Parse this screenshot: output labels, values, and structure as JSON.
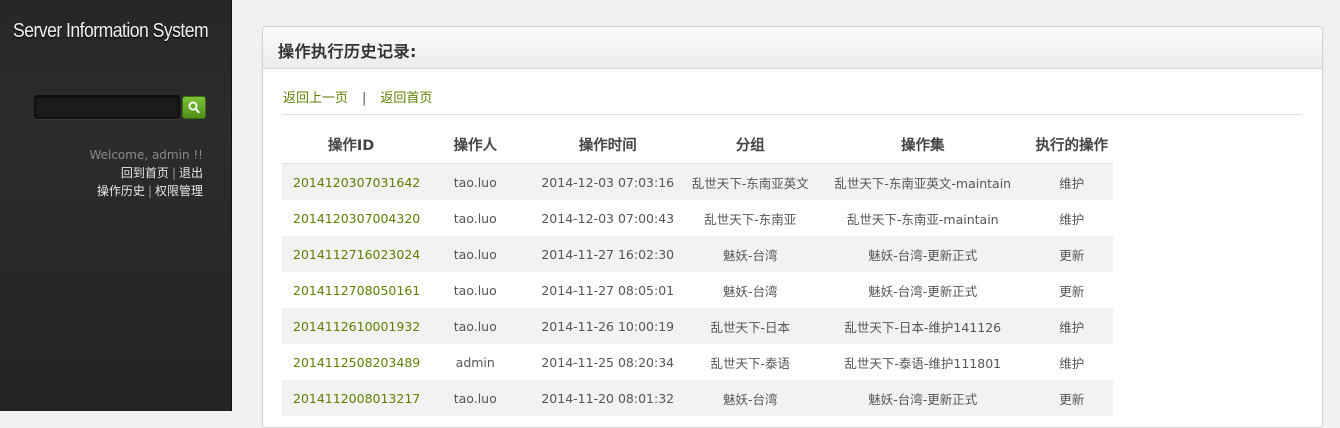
{
  "sidebar": {
    "app_title": "Server Information System",
    "search": {
      "value": "",
      "placeholder": ""
    },
    "welcome": "Welcome, admin !!",
    "links": {
      "home": "回到首页",
      "logout": "退出",
      "history": "操作历史",
      "permissions": "权限管理",
      "separator": "|"
    }
  },
  "panel": {
    "title": "操作执行历史记录:",
    "nav": {
      "back": "返回上一页",
      "separator": "|",
      "home": "返回首页"
    },
    "table": {
      "headers": [
        "操作ID",
        "操作人",
        "操作时间",
        "分组",
        "操作集",
        "执行的操作"
      ],
      "rows": [
        [
          "2014120307031642",
          "tao.luo",
          "2014-12-03 07:03:16",
          "乱世天下-东南亚英文",
          "乱世天下-东南亚英文-maintain",
          "维护"
        ],
        [
          "2014120307004320",
          "tao.luo",
          "2014-12-03 07:00:43",
          "乱世天下-东南亚",
          "乱世天下-东南亚-maintain",
          "维护"
        ],
        [
          "2014112716023024",
          "tao.luo",
          "2014-11-27 16:02:30",
          "魅妖-台湾",
          "魅妖-台湾-更新正式",
          "更新"
        ],
        [
          "2014112708050161",
          "tao.luo",
          "2014-11-27 08:05:01",
          "魅妖-台湾",
          "魅妖-台湾-更新正式",
          "更新"
        ],
        [
          "2014112610001932",
          "tao.luo",
          "2014-11-26 10:00:19",
          "乱世天下-日本",
          "乱世天下-日本-维护141126",
          "维护"
        ],
        [
          "2014112508203489",
          "admin",
          "2014-11-25 08:20:34",
          "乱世天下-泰语",
          "乱世天下-泰语-维护111801",
          "维护"
        ],
        [
          "2014112008013217",
          "tao.luo",
          "2014-11-20 08:01:32",
          "魅妖-台湾",
          "魅妖-台湾-更新正式",
          "更新"
        ]
      ]
    }
  },
  "colors": {
    "sidebar_bg": "#262626",
    "accent_green": "#5e7f00",
    "search_button": "#6aad2a",
    "row_stripe": "#f2f2f2"
  }
}
